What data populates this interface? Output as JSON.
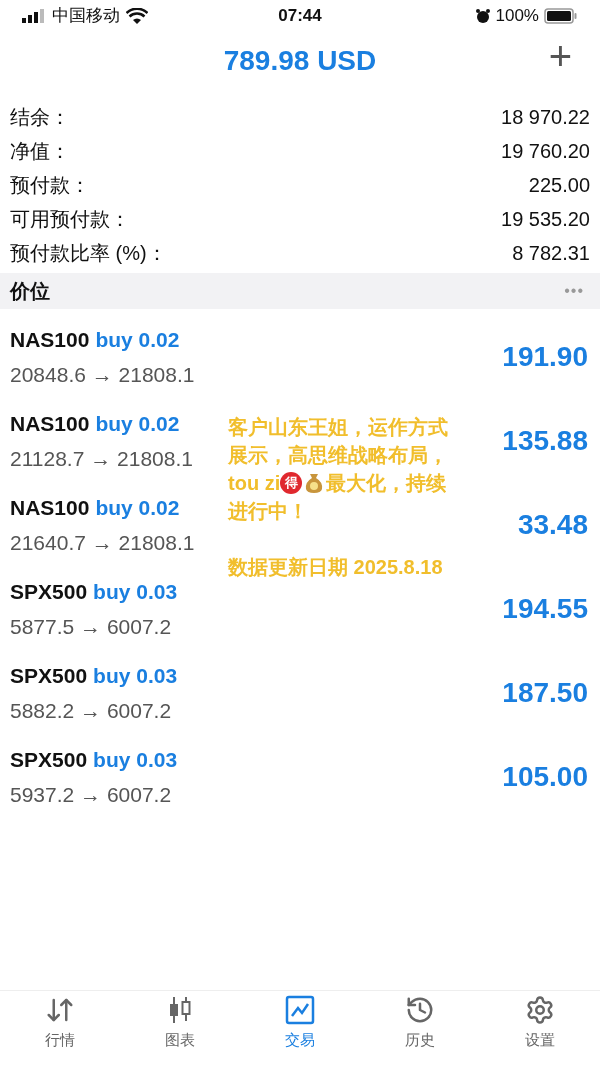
{
  "status_bar": {
    "carrier": "中国移动",
    "time": "07:44",
    "battery": "100%"
  },
  "header": {
    "title": "789.98 USD",
    "add": "+"
  },
  "summary": [
    {
      "label": "结余：",
      "value": "18 970.22"
    },
    {
      "label": "净值：",
      "value": "19 760.20"
    },
    {
      "label": "预付款：",
      "value": "225.00"
    },
    {
      "label": "可用预付款：",
      "value": "19 535.20"
    },
    {
      "label": "预付款比率 (%)：",
      "value": "8 782.31"
    }
  ],
  "section": {
    "title": "价位",
    "more": "•••"
  },
  "positions": [
    {
      "symbol": "NAS100",
      "side": "buy 0.02",
      "prices": "20848.6 → 21808.1",
      "profit": "191.90"
    },
    {
      "symbol": "NAS100",
      "side": "buy 0.02",
      "prices": "21128.7 → 21808.1",
      "profit": "135.88"
    },
    {
      "symbol": "NAS100",
      "side": "buy 0.02",
      "prices": "21640.7 → 21808.1",
      "profit": "33.48"
    },
    {
      "symbol": "SPX500",
      "side": "buy 0.03",
      "prices": "5877.5 → 6007.2",
      "profit": "194.55"
    },
    {
      "symbol": "SPX500",
      "side": "buy 0.03",
      "prices": "5882.2 → 6007.2",
      "profit": "187.50"
    },
    {
      "symbol": "SPX500",
      "side": "buy 0.03",
      "prices": "5937.2 → 6007.2",
      "profit": "105.00"
    }
  ],
  "overlay": {
    "lines": [
      {
        "segments": [
          {
            "kind": "text",
            "text": "客户山东王姐，运作方式"
          }
        ]
      },
      {
        "segments": [
          {
            "kind": "text",
            "text": "展示，高思维战略布局，"
          }
        ]
      },
      {
        "segments": [
          {
            "kind": "text",
            "text": "tou zi"
          },
          {
            "kind": "badge",
            "text": "得"
          },
          {
            "kind": "moneybag"
          },
          {
            "kind": "text",
            "text": "最大化，持续"
          }
        ]
      },
      {
        "segments": [
          {
            "kind": "text",
            "text": "进行中！"
          }
        ]
      }
    ],
    "date_line": "数据更新日期 2025.8.18"
  },
  "tabs": [
    {
      "kind": "quotes",
      "label": "行情",
      "selected": false
    },
    {
      "kind": "chart",
      "label": "图表",
      "selected": false
    },
    {
      "kind": "trade",
      "label": "交易",
      "selected": true
    },
    {
      "kind": "history",
      "label": "历史",
      "selected": false
    },
    {
      "kind": "settings",
      "label": "设置",
      "selected": false
    }
  ]
}
